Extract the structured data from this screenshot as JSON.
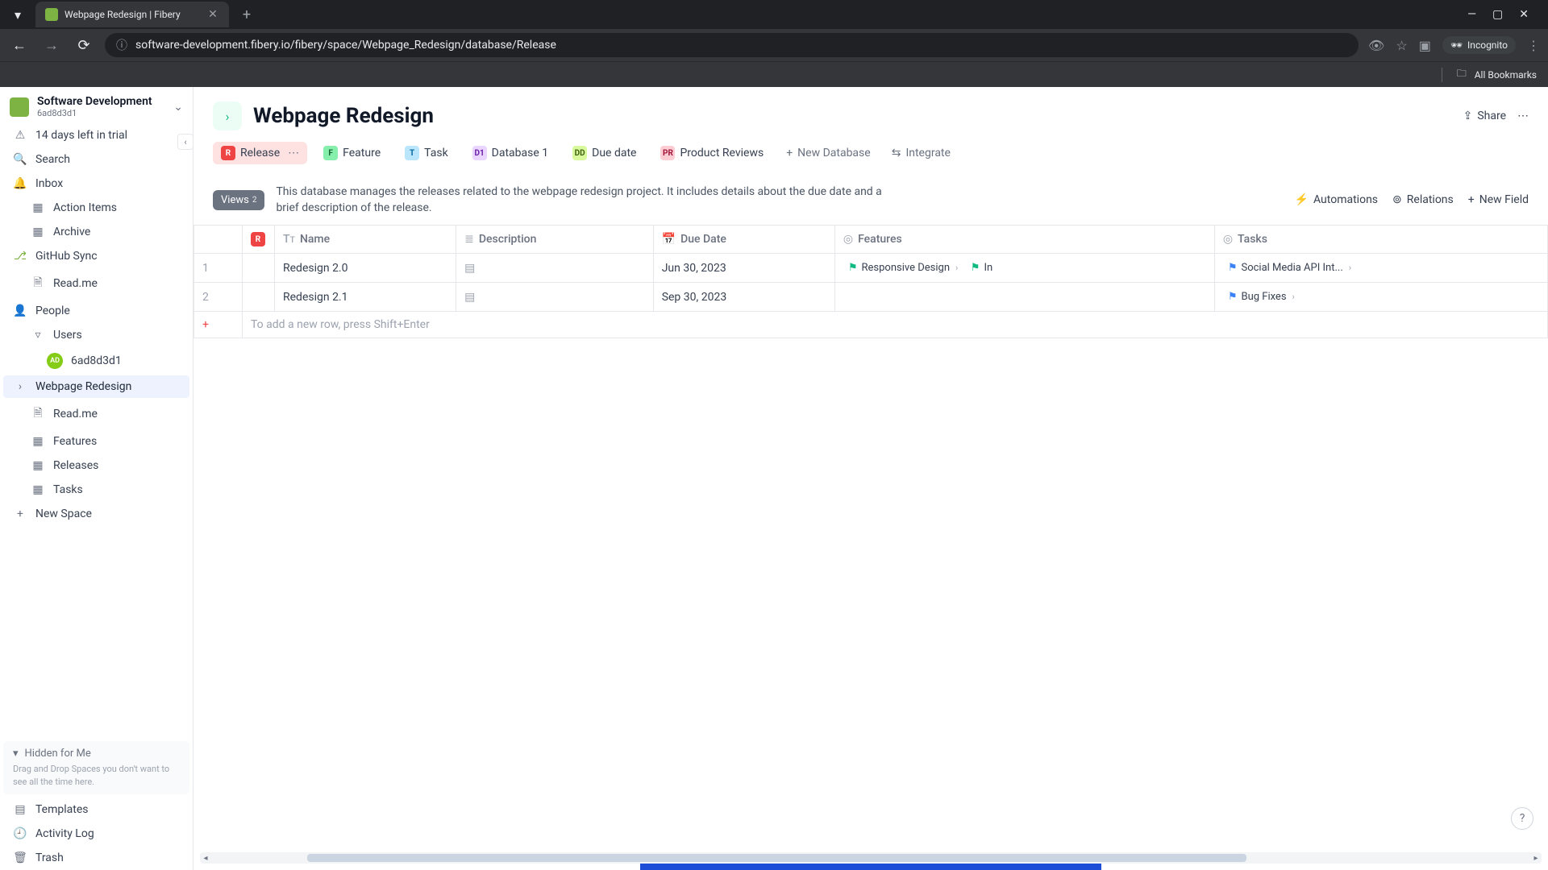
{
  "chrome": {
    "tab_title": "Webpage Redesign | Fibery",
    "url": "software-development.fibery.io/fibery/space/Webpage_Redesign/database/Release",
    "incognito_label": "Incognito",
    "all_bookmarks": "All Bookmarks"
  },
  "workspace": {
    "name": "Software Development",
    "id": "6ad8d3d1"
  },
  "sidebar": {
    "trial": "14 days left in trial",
    "search": "Search",
    "inbox": "Inbox",
    "action_items": "Action Items",
    "archive": "Archive",
    "github_sync": "GitHub Sync",
    "readme1": "Read.me",
    "people": "People",
    "users": "Users",
    "user_id": "6ad8d3d1",
    "webpage_redesign": "Webpage Redesign",
    "readme2": "Read.me",
    "features": "Features",
    "releases": "Releases",
    "tasks": "Tasks",
    "new_space": "New Space",
    "hidden_label": "Hidden for Me",
    "hidden_hint": "Drag and Drop Spaces you don't want to see all the time here.",
    "templates": "Templates",
    "activity_log": "Activity Log",
    "trash": "Trash"
  },
  "page": {
    "title": "Webpage Redesign",
    "share": "Share"
  },
  "db_tabs": {
    "release": "Release",
    "feature": "Feature",
    "task": "Task",
    "database1": "Database 1",
    "due_date": "Due date",
    "product_reviews": "Product Reviews",
    "new_database": "New Database",
    "integrate": "Integrate"
  },
  "toolbar": {
    "views": "Views",
    "views_count": "2",
    "description": "This database manages the releases related to the webpage redesign project. It includes details about the due date and a brief description of the release.",
    "automations": "Automations",
    "relations": "Relations",
    "new_field": "New Field"
  },
  "columns": {
    "name": "Name",
    "description": "Description",
    "due_date": "Due Date",
    "features": "Features",
    "tasks": "Tasks"
  },
  "rows": [
    {
      "num": "1",
      "name": "Redesign 2.0",
      "due": "Jun 30, 2023",
      "features": [
        "Responsive Design",
        "In"
      ],
      "tasks": [
        "Social Media API Int..."
      ]
    },
    {
      "num": "2",
      "name": "Redesign 2.1",
      "due": "Sep 30, 2023",
      "features": [],
      "tasks": [
        "Bug Fixes"
      ]
    }
  ],
  "add_row_hint": "To add a new row, press Shift+Enter"
}
